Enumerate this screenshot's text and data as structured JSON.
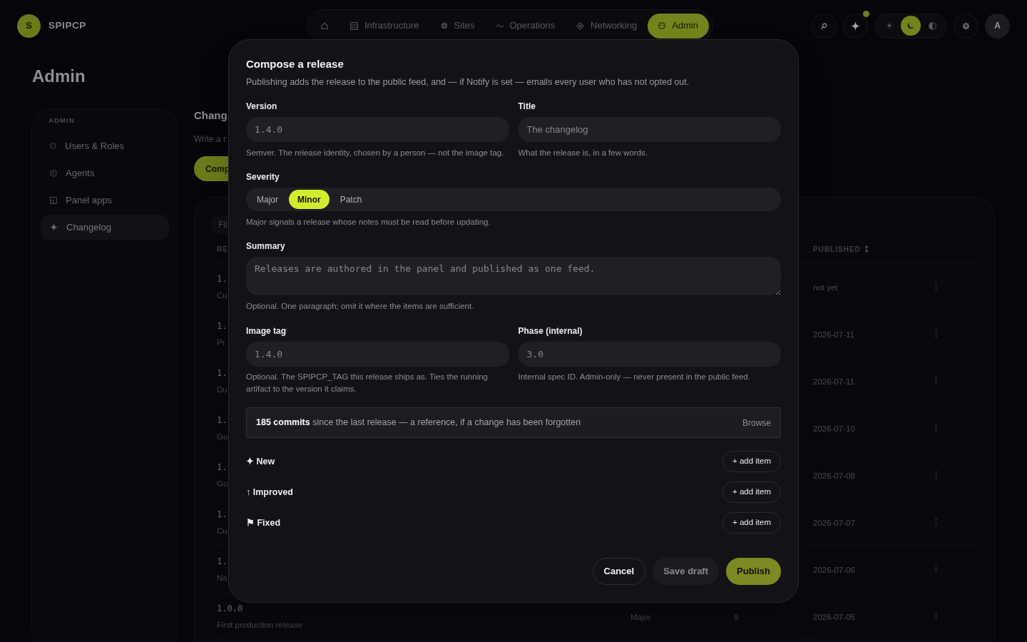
{
  "header": {
    "logo_letter": "S",
    "brand": "SPIPCP",
    "nav": [
      {
        "kind": "icon",
        "selected": false
      },
      {
        "kind": "text",
        "label": "Infrastructure",
        "selected": false
      },
      {
        "kind": "text",
        "label": "Sites",
        "selected": false
      },
      {
        "kind": "text",
        "label": "Operations",
        "selected": false
      },
      {
        "kind": "text",
        "label": "Networking",
        "selected": false
      },
      {
        "kind": "text",
        "label": "Admin",
        "selected": true
      }
    ],
    "notification": true,
    "theme": [
      {
        "selected": false
      },
      {
        "selected": true
      },
      {
        "selected": false
      }
    ],
    "avatar": "A"
  },
  "page_title": "Admin",
  "sidebar": {
    "section": "ADMIN",
    "items": [
      {
        "label": "Users & Roles",
        "selected": false
      },
      {
        "label": "Agents",
        "selected": false
      },
      {
        "label": "Panel apps",
        "selected": false
      },
      {
        "label": "Changelog",
        "selected": true
      }
    ]
  },
  "main": {
    "heading": "Chang",
    "subtitle": "Write a r",
    "compose_button": "Comp",
    "filter": {
      "placeholder": "Fil"
    },
    "table": {
      "columns": [
        {
          "kind": "release",
          "label": "RE",
          "sortable": false
        },
        {
          "kind": "published",
          "label": "PUBLISHED",
          "sortable": true
        }
      ],
      "rows": [
        {
          "version": "1.",
          "summary": "Cu",
          "published": "not yet"
        },
        {
          "version": "1.",
          "summary": "Pr",
          "published": "2026-07-11"
        },
        {
          "version": "1.",
          "summary": "Du",
          "published": "2026-07-11"
        },
        {
          "version": "1.",
          "summary": "Gu",
          "published": "2026-07-10"
        },
        {
          "version": "1.",
          "summary": "Go",
          "published": "2026-07-08"
        },
        {
          "version": "1.",
          "summary": "Cu",
          "published": "2026-07-07"
        },
        {
          "version": "1.",
          "summary": "Na",
          "published": "2026-07-06"
        },
        {
          "version": "1.0.0",
          "summary": "First production release",
          "severity": "Major",
          "items": "9",
          "published": "2026-07-05"
        }
      ]
    }
  },
  "dialog": {
    "title": "Compose a release",
    "description": "Publishing adds the release to the public feed, and — if Notify is set — emails every user who has not opted out.",
    "fields_top": [
      {
        "label": "Version",
        "kind": "code",
        "placeholder": "1.4.0",
        "help": "Semver. The release identity, chosen by a person — not the image tag."
      },
      {
        "label": "Title",
        "kind": "text",
        "placeholder": "The changelog",
        "help": "What the release is, in a few words."
      }
    ],
    "severity": {
      "label": "Severity",
      "options": [
        {
          "label": "Major",
          "selected": false
        },
        {
          "label": "Minor",
          "selected": true
        },
        {
          "label": "Patch",
          "selected": false
        }
      ],
      "help": "Major signals a release whose notes must be read before updating."
    },
    "summary": {
      "label": "Summary",
      "placeholder": "Releases are authored in the panel and published as one feed.",
      "help": "Optional. One paragraph; omit it where the items are sufficient."
    },
    "fields_bottom": [
      {
        "label": "Image tag",
        "kind": "code",
        "placeholder": "1.4.0",
        "help": "Optional. The SPIPCP_TAG this release ships as. Ties the running artifact to the version it claims."
      },
      {
        "label": "Phase (internal)",
        "kind": "code",
        "placeholder": "3.0",
        "help": "Internal spec ID. Admin-only — never present in the public feed."
      }
    ],
    "commits": {
      "text": "**185 commits** since the last release — a reference, if a change has been forgotten",
      "link": "Browse"
    },
    "sections": [
      {
        "label": "✦ New",
        "button": "+ add item"
      },
      {
        "label": "↑ Improved",
        "button": "+ add item"
      },
      {
        "label": "⚑ Fixed",
        "button": "+ add item"
      }
    ],
    "buttons": [
      {
        "label": "Cancel",
        "kind": "outline",
        "disabled": false
      },
      {
        "label": "Save draft",
        "kind": "secondary",
        "disabled": true
      },
      {
        "label": "Publish",
        "kind": "primary",
        "disabled": true
      }
    ]
  }
}
